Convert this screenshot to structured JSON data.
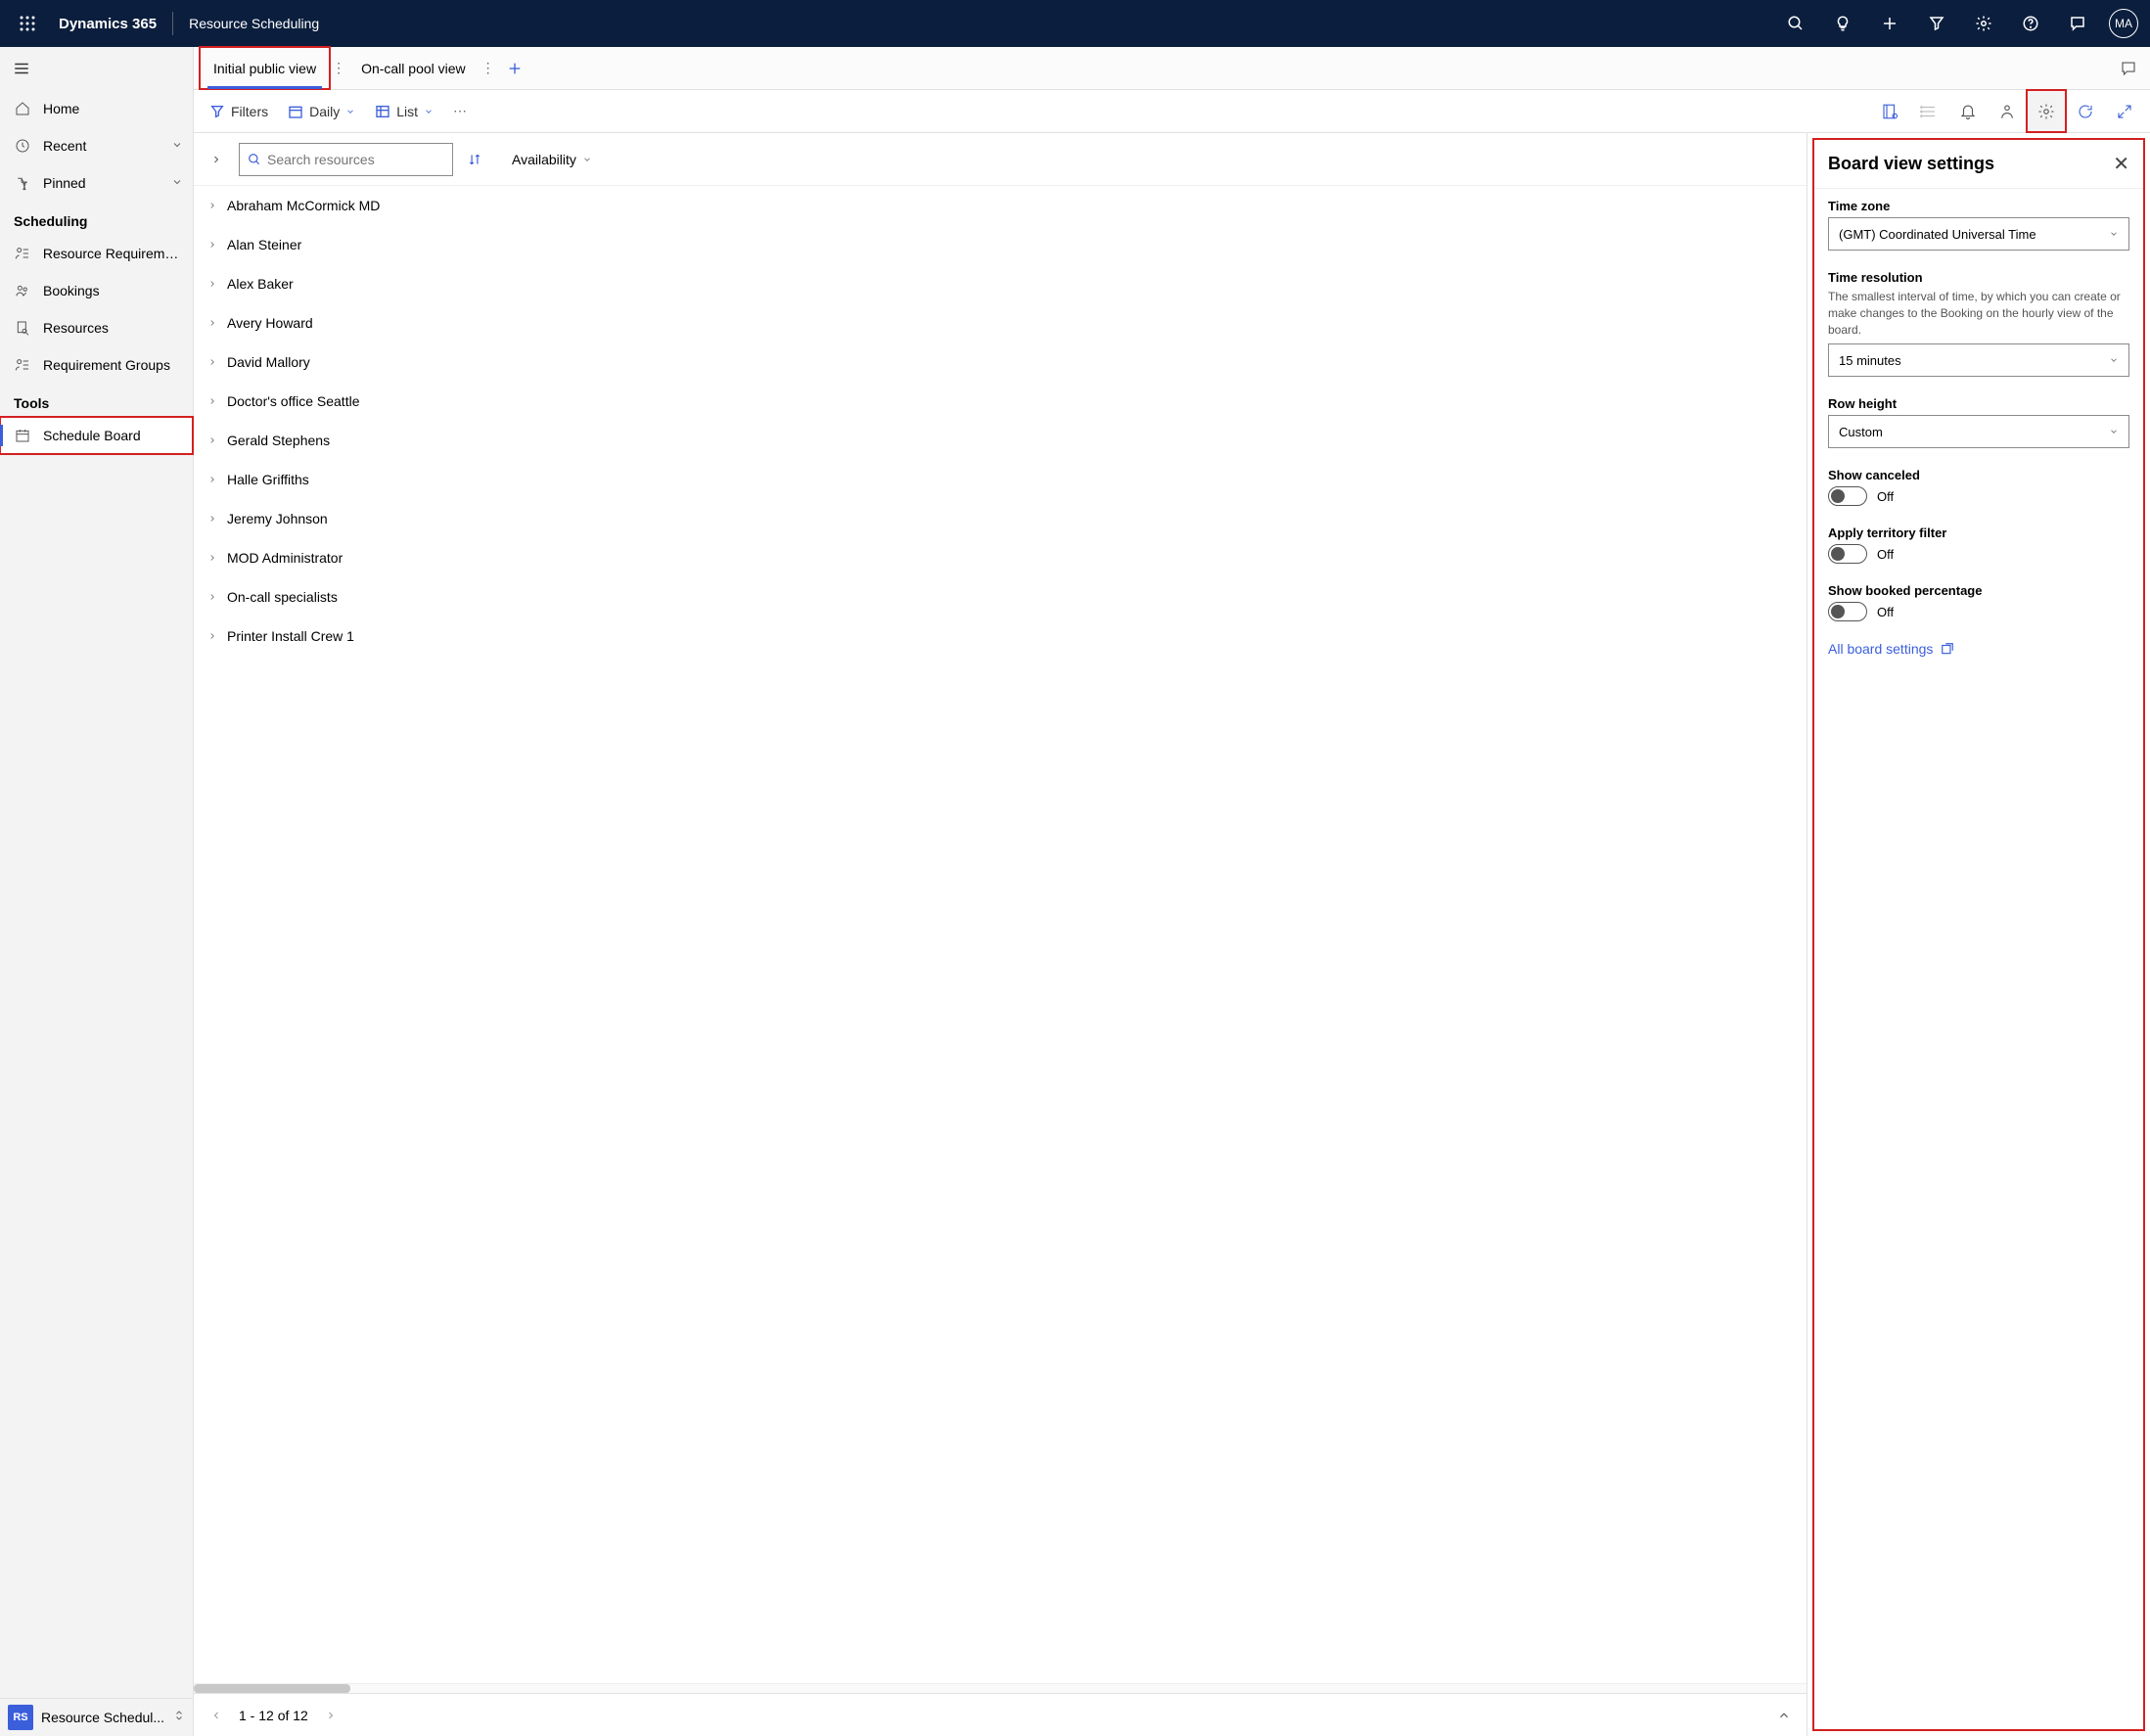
{
  "topbar": {
    "brand": "Dynamics 365",
    "app_title": "Resource Scheduling",
    "avatar_initials": "MA"
  },
  "sidebar": {
    "items_top": [
      {
        "icon": "home",
        "label": "Home"
      },
      {
        "icon": "clock",
        "label": "Recent",
        "chevron": true
      },
      {
        "icon": "pin",
        "label": "Pinned",
        "chevron": true
      }
    ],
    "section_scheduling": "Scheduling",
    "items_sched": [
      {
        "icon": "people-lines",
        "label": "Resource Requireme..."
      },
      {
        "icon": "people",
        "label": "Bookings"
      },
      {
        "icon": "doc-search",
        "label": "Resources"
      },
      {
        "icon": "people-lines",
        "label": "Requirement Groups"
      }
    ],
    "section_tools": "Tools",
    "items_tools": [
      {
        "icon": "calendar",
        "label": "Schedule Board",
        "selected": true,
        "redbox": true
      }
    ],
    "footer_chip": "RS",
    "footer_label": "Resource Schedul..."
  },
  "tabs": [
    {
      "label": "Initial public view",
      "active": true,
      "redbox": true
    },
    {
      "label": "On-call pool view"
    }
  ],
  "toolbar": {
    "filters": "Filters",
    "daily": "Daily",
    "list": "List",
    "gear_active": true
  },
  "resources_header": {
    "search_placeholder": "Search resources",
    "availability": "Availability"
  },
  "resources": [
    "Abraham McCormick MD",
    "Alan Steiner",
    "Alex Baker",
    "Avery Howard",
    "David Mallory",
    "Doctor's office Seattle",
    "Gerald Stephens",
    "Halle Griffiths",
    "Jeremy Johnson",
    "MOD Administrator",
    "On-call specialists",
    "Printer Install Crew 1"
  ],
  "pager": {
    "text": "1 - 12 of 12"
  },
  "settings": {
    "title": "Board view settings",
    "timezone_label": "Time zone",
    "timezone_value": "(GMT) Coordinated Universal Time",
    "timeres_label": "Time resolution",
    "timeres_help": "The smallest interval of time, by which you can create or make changes to the Booking on the hourly view of the board.",
    "timeres_value": "15 minutes",
    "rowheight_label": "Row height",
    "rowheight_value": "Custom",
    "showcanceled_label": "Show canceled",
    "showcanceled_state": "Off",
    "territory_label": "Apply territory filter",
    "territory_state": "Off",
    "booked_label": "Show booked percentage",
    "booked_state": "Off",
    "all_settings_label": "All board settings"
  }
}
